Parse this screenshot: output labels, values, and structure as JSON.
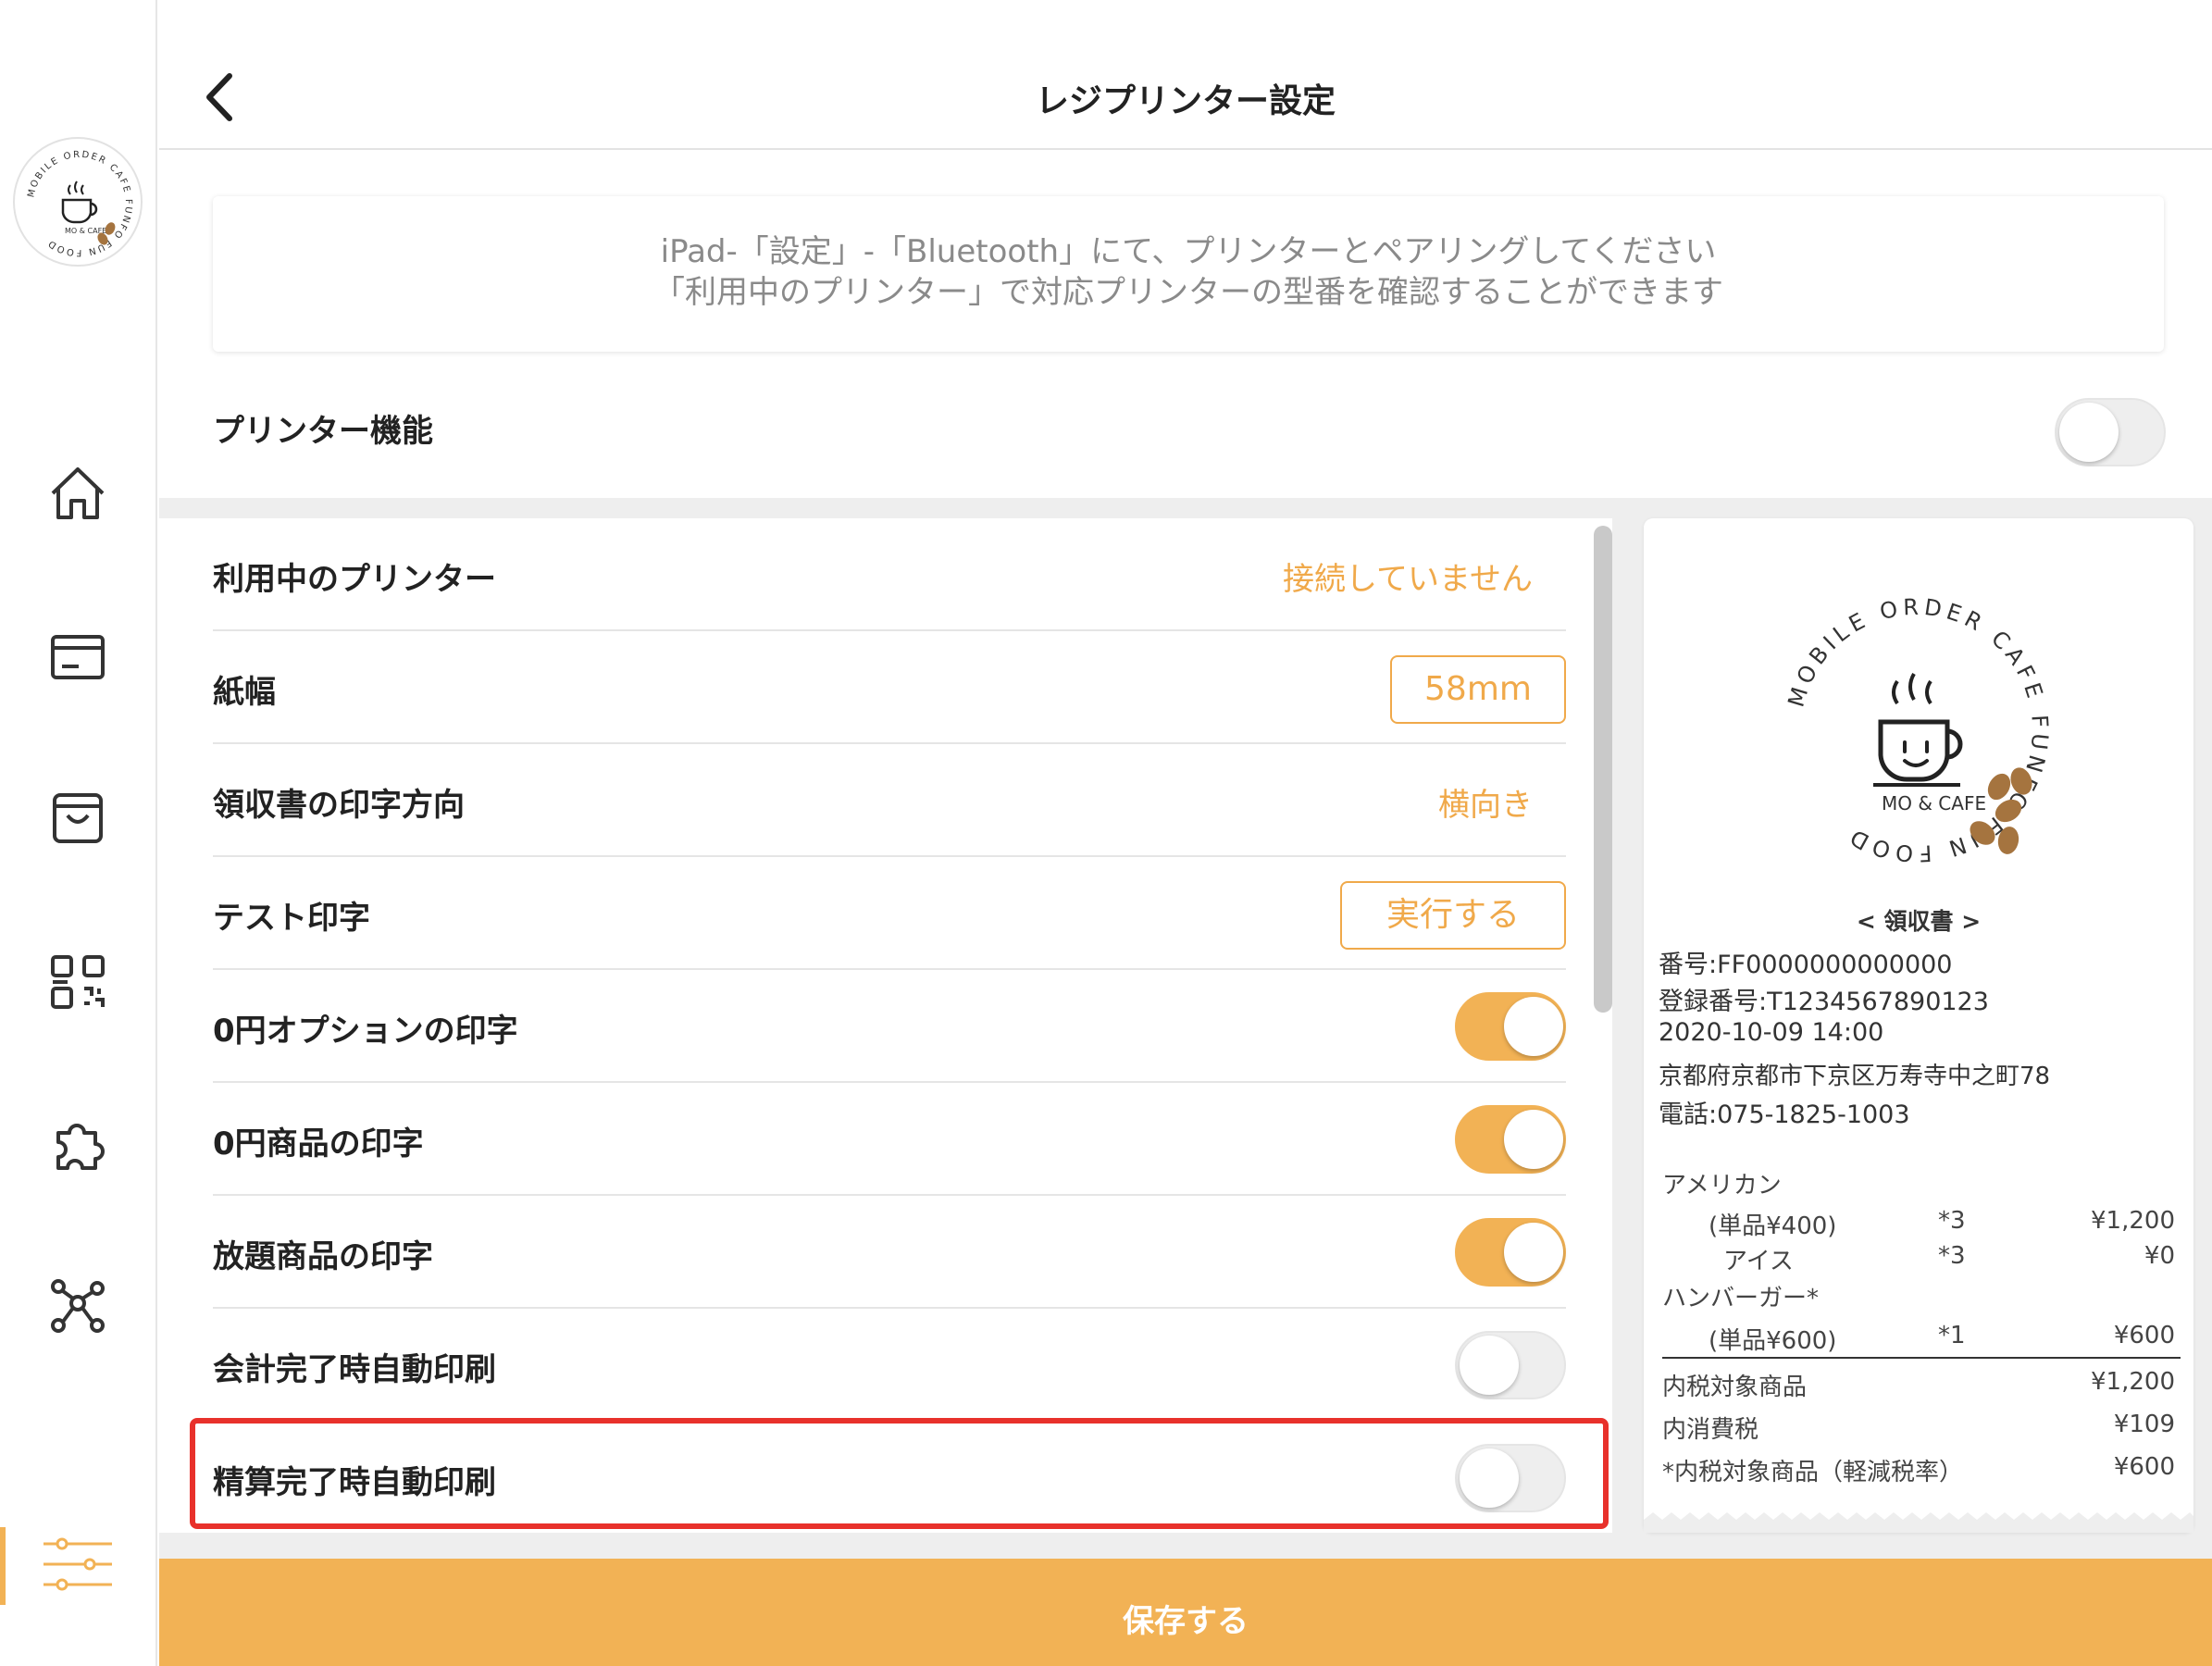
{
  "header": {
    "title": "レジプリンター設定"
  },
  "brand": {
    "ring_text": "MOBILE ORDER CAFE FUNFO FUN FOOD",
    "logo_text": "MO & CAFE",
    "accent": "#f2b255",
    "accent_text": "#f0a94a",
    "highlight": "#e8312b"
  },
  "sidebar": {
    "items": [
      {
        "name": "home-icon",
        "active": false
      },
      {
        "name": "register-icon",
        "active": false
      },
      {
        "name": "bag-icon",
        "active": false
      },
      {
        "name": "qr-code-icon",
        "active": false
      },
      {
        "name": "puzzle-icon",
        "active": false
      },
      {
        "name": "network-icon",
        "active": false
      },
      {
        "name": "settings-sliders-icon",
        "active": true
      }
    ]
  },
  "info": {
    "line1": "iPad-「設定」-「Bluetooth」にて、プリンターとペアリングしてください",
    "line2": "「利用中のプリンター」で対応プリンターの型番を確認することができます"
  },
  "printer_function": {
    "label": "プリンター機能",
    "on": false
  },
  "settings": {
    "current_printer": {
      "label": "利用中のプリンター",
      "value": "接続していません"
    },
    "paper_width": {
      "label": "紙幅",
      "value": "58mm"
    },
    "receipt_direction": {
      "label": "領収書の印字方向",
      "value": "横向き"
    },
    "test_print": {
      "label": "テスト印字",
      "button": "実行する"
    },
    "zero_option": {
      "label": "0円オプションの印字",
      "on": true
    },
    "zero_item": {
      "label": "0円商品の印字",
      "on": true
    },
    "unlimited_item": {
      "label": "放題商品の印字",
      "on": true
    },
    "auto_print_checkout": {
      "label": "会計完了時自動印刷",
      "on": false
    },
    "auto_print_settlement": {
      "label": "精算完了時自動印刷",
      "on": false
    }
  },
  "receipt": {
    "heading": "< 領収書 >",
    "number": "番号:FF0000000000000",
    "registration": "登録番号:T1234567890123",
    "datetime": "2020-10-09 14:00",
    "address": "京都府京都市下京区万寿寺中之町78",
    "phone": "電話:075-1825-1003",
    "items": [
      {
        "name": "アメリカン"
      },
      {
        "sub": "(単品¥400)",
        "qty": "*3",
        "price": "¥1,200"
      },
      {
        "sub": "アイス",
        "qty": "*3",
        "price": "¥0"
      },
      {
        "name": "ハンバーガー*"
      },
      {
        "sub": "(単品¥600)",
        "qty": "*1",
        "price": "¥600"
      }
    ],
    "totals": [
      {
        "label": "内税対象商品",
        "value": "¥1,200"
      },
      {
        "label": "内消費税",
        "value": "¥109"
      },
      {
        "label": "*内税対象商品（軽減税率）",
        "value": "¥600"
      }
    ]
  },
  "footer": {
    "save_label": "保存する"
  }
}
